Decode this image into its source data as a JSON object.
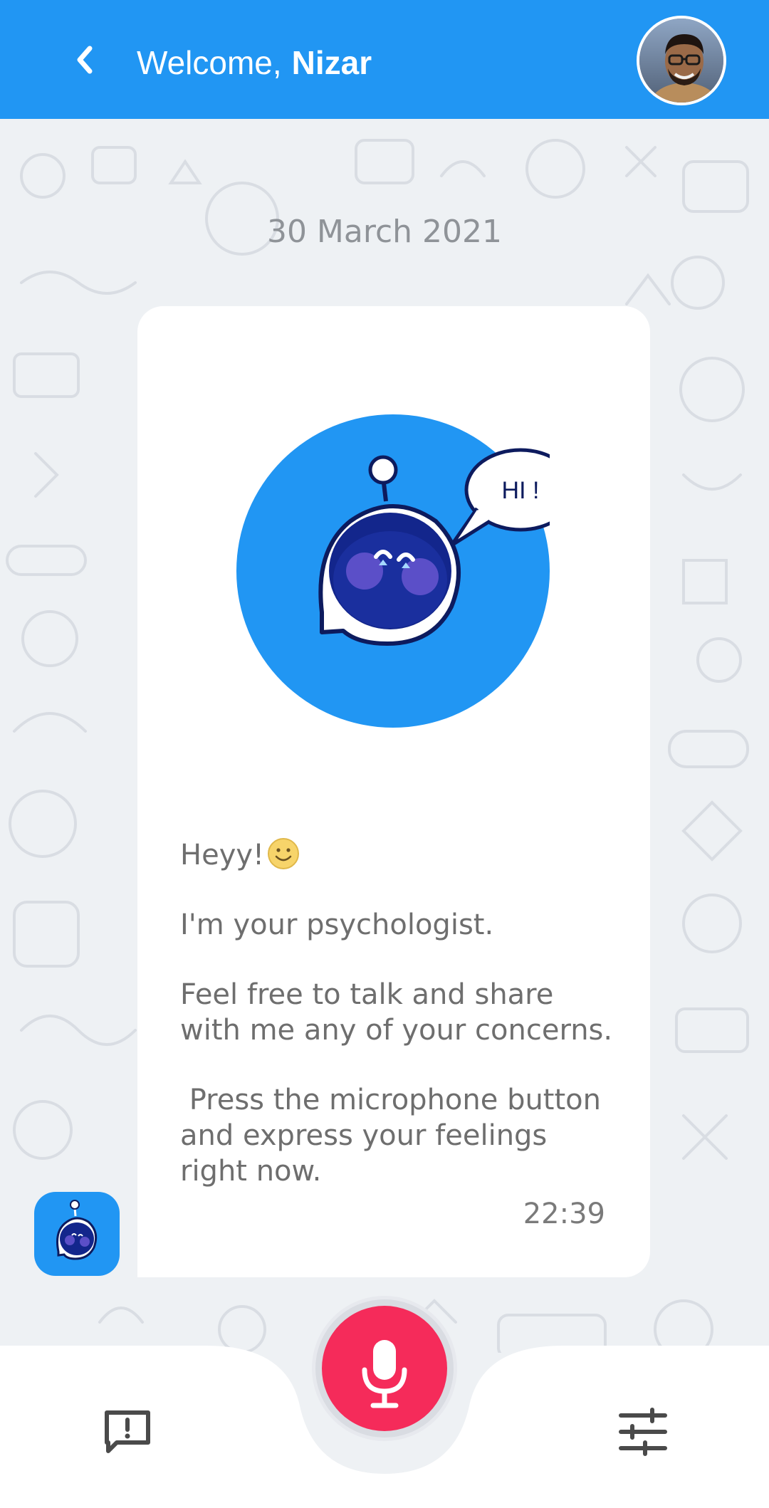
{
  "header": {
    "greeting": "Welcome,",
    "user_name": "Nizar",
    "back_icon": "chevron-left-icon",
    "avatar_icon": "user-avatar"
  },
  "chat": {
    "date": "30 March 2021",
    "illustration": {
      "speech_text": "HI !"
    },
    "message": {
      "greeting": "Heyy!",
      "line_intro": "I'm your psychologist.",
      "line_share": "Feel free to talk and share with me any of your concerns.",
      "line_action": " Press the microphone button and express your feelings right now.",
      "time": "22:39"
    }
  },
  "bottom_nav": {
    "left_icon": "feedback-icon",
    "center_icon": "microphone-icon",
    "right_icon": "settings-sliders-icon"
  },
  "colors": {
    "primary": "#2196f3",
    "mic": "#f52b5a",
    "robot_dark": "#0d1b5e",
    "background": "#eef1f4"
  }
}
